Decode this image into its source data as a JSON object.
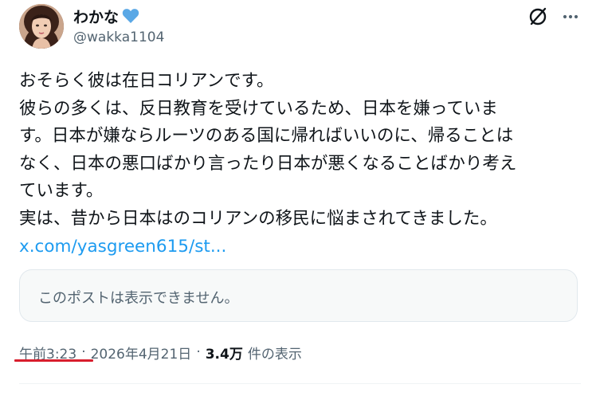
{
  "user": {
    "display_name": "わかな",
    "handle": "@wakka1104",
    "verified_heart_color": "#5aa8e6"
  },
  "header": {
    "grok_icon": "grok-slash-circle-icon",
    "more_icon": "more-horizontal-icon"
  },
  "tweet": {
    "line1": "おそらく彼は在日コリアンです。",
    "line2": "彼らの多くは、反日教育を受けているため、日本を嫌っていま\nす。日本が嫌ならルーツのある国に帰ればいいのに、帰ることは\nなく、日本の悪口ばかり言ったり日本が悪くなることばかり考え\nています。",
    "line3": "実は、昔から日本はのコリアンの移民に悩まされてきました。",
    "link": "x.com/yasgreen615/st..."
  },
  "quote_card": {
    "text": "このポストは表示できません。"
  },
  "meta": {
    "time": "午前3:23",
    "separator": "·",
    "date": "2026年4月21日",
    "views_count": "3.4万",
    "views_label": "件の表示"
  },
  "colors": {
    "link": "#1d9bf0",
    "secondary_text": "#536471",
    "annotation_underline": "#d81e2d"
  }
}
